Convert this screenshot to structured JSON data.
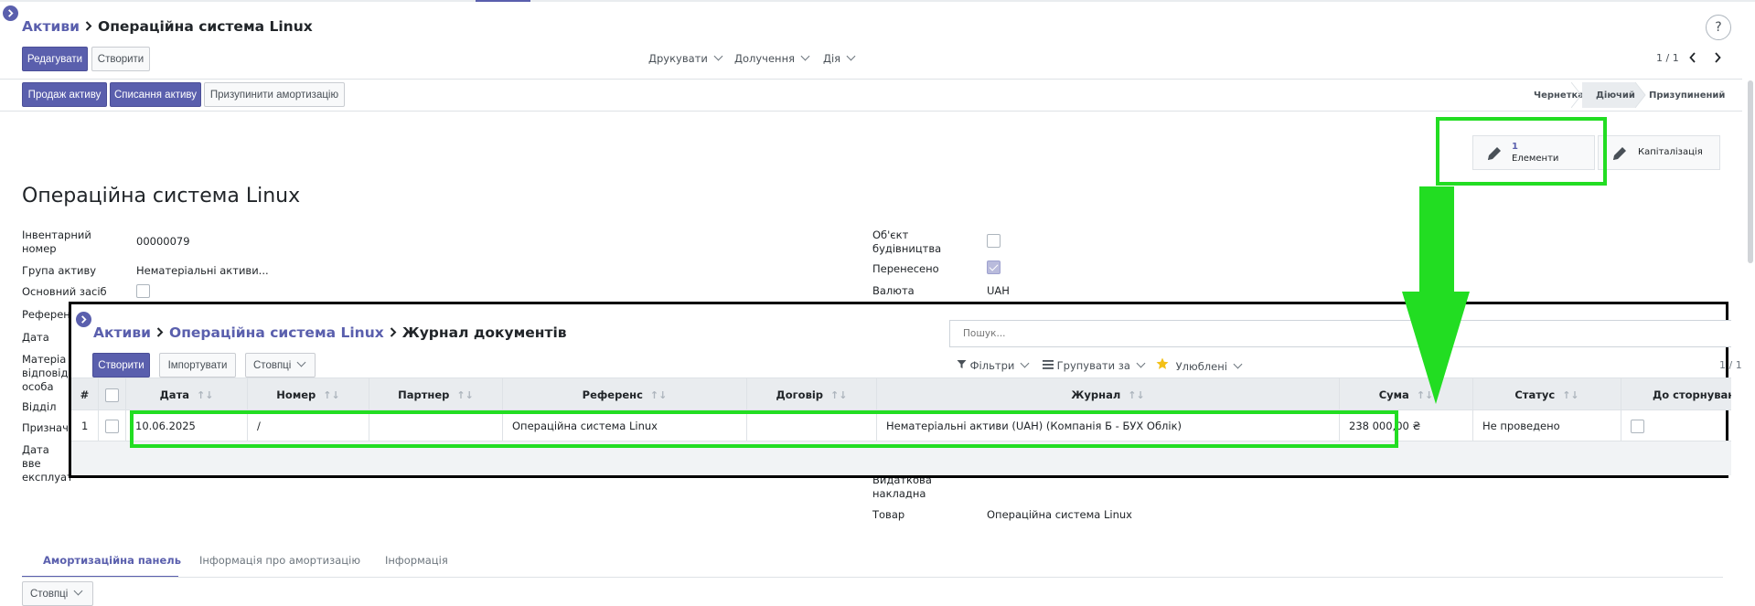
{
  "breadcrumb": {
    "root": "Активи",
    "current": "Операційна система Linux"
  },
  "toolbar": {
    "edit_label": "Редагувати",
    "create_label": "Створити",
    "print_label": "Друкувати",
    "attach_label": "Долучення",
    "action_label": "Дія",
    "pager": "1 / 1"
  },
  "actions": {
    "sell_label": "Продаж активу",
    "writeoff_label": "Списання активу",
    "pause_label": "Призупинити амортизацію"
  },
  "statusbar": [
    "Чернетка",
    "Діючий",
    "Призупинений"
  ],
  "smart_buttons": {
    "elements_count": "1",
    "elements_label": "Елементи",
    "capitalization_label": "Капіталізація"
  },
  "form": {
    "title": "Операційна система Linux",
    "left": {
      "inventory_label": "Інвентарний номер",
      "inventory_value": "00000079",
      "group_label": "Група активу",
      "group_value": "Нематеріальні активи...",
      "fixed_asset_label": "Основний засіб",
      "reference_label": "Референ",
      "date_label": "Дата",
      "responsible_label": "Матеріа відповід особа",
      "department_label": "Відділ",
      "purpose_label": "Признач",
      "commission_label": "Дата вве експлуат"
    },
    "right": {
      "construction_label": "Об'єкт будівництва",
      "transferred_label": "Перенесено",
      "currency_label": "Валюта",
      "currency_value": "UAH",
      "invoice_label": "Видаткова накладна",
      "product_label": "Товар",
      "product_value": "Операційна система Linux"
    },
    "tabs": [
      "Амортизаційна панель",
      "Інформація про амортизацію",
      "Інформація"
    ],
    "columns_label": "Стовпці"
  },
  "popup": {
    "breadcrumb": [
      "Активи",
      "Операційна система Linux",
      "Журнал документів"
    ],
    "search_placeholder": "Пошук...",
    "create_label": "Створити",
    "import_label": "Імпортувати",
    "columns_label": "Стовпці",
    "filters_label": "Фільтри",
    "group_label": "Групувати за",
    "favorites_label": "Улюблені",
    "pager": "1 / 1",
    "headers": [
      "#",
      "Дата",
      "Номер",
      "Партнер",
      "Референс",
      "Договір",
      "Журнал",
      "Сума",
      "Статус",
      "До сторнування"
    ],
    "rows": [
      {
        "n": "1",
        "date": "10.06.2025",
        "number": "/",
        "partner": "",
        "reference": "Операційна система Linux",
        "contract": "",
        "journal": "Нематеріальні активи (UAH) (Компанія Б - БУХ Облік)",
        "amount": "238 000,00 ₴",
        "status": "Не проведено"
      }
    ]
  },
  "colors": {
    "primary": "#5a5fad",
    "highlight": "#22dd22",
    "frame": "#000000"
  }
}
